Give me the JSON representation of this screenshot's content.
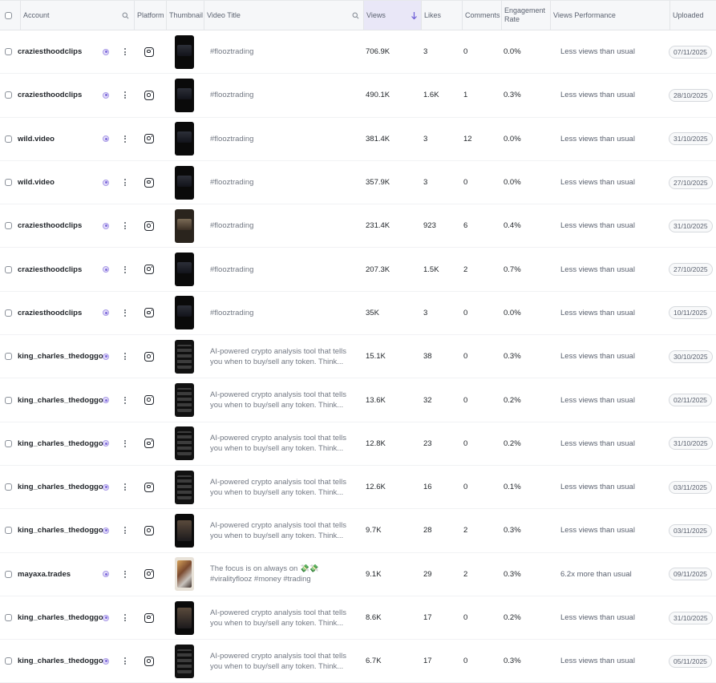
{
  "header": {
    "account": "Account",
    "platform": "Platform",
    "thumbnail": "Thumbnail",
    "video_title": "Video Title",
    "views": "Views",
    "likes": "Likes",
    "comments": "Comments",
    "engagement_line1": "Engagement",
    "engagement_line2": "Rate",
    "views_performance": "Views Performance",
    "uploaded": "Uploaded"
  },
  "rows": [
    {
      "account": "craziesthoodclips",
      "title": "#flooztrading",
      "views": "706.9K",
      "likes": "3",
      "comments": "0",
      "engagement": "0.0%",
      "performance": "Less views than usual",
      "uploaded": "07/11/2025"
    },
    {
      "account": "craziesthoodclips",
      "title": "#flooztrading",
      "views": "490.1K",
      "likes": "1.6K",
      "comments": "1",
      "engagement": "0.3%",
      "performance": "Less views than usual",
      "uploaded": "28/10/2025"
    },
    {
      "account": "wild.video",
      "title": "#flooztrading",
      "views": "381.4K",
      "likes": "3",
      "comments": "12",
      "engagement": "0.0%",
      "performance": "Less views than usual",
      "uploaded": "31/10/2025"
    },
    {
      "account": "wild.video",
      "title": "#flooztrading",
      "views": "357.9K",
      "likes": "3",
      "comments": "0",
      "engagement": "0.0%",
      "performance": "Less views than usual",
      "uploaded": "27/10/2025"
    },
    {
      "account": "craziesthoodclips",
      "title": "#flooztrading",
      "views": "231.4K",
      "likes": "923",
      "comments": "6",
      "engagement": "0.4%",
      "performance": "Less views than usual",
      "uploaded": "31/10/2025"
    },
    {
      "account": "craziesthoodclips",
      "title": "#flooztrading",
      "views": "207.3K",
      "likes": "1.5K",
      "comments": "2",
      "engagement": "0.7%",
      "performance": "Less views than usual",
      "uploaded": "27/10/2025"
    },
    {
      "account": "craziesthoodclips",
      "title": "#flooztrading",
      "views": "35K",
      "likes": "3",
      "comments": "0",
      "engagement": "0.0%",
      "performance": "Less views than usual",
      "uploaded": "10/11/2025"
    },
    {
      "account": "king_charles_thedoggo",
      "title": "AI-powered crypto analysis tool that tells you when to buy/sell any token. Think...",
      "views": "15.1K",
      "likes": "38",
      "comments": "0",
      "engagement": "0.3%",
      "performance": "Less views than usual",
      "uploaded": "30/10/2025"
    },
    {
      "account": "king_charles_thedoggo",
      "title": "AI-powered crypto analysis tool that tells you when to buy/sell any token. Think...",
      "views": "13.6K",
      "likes": "32",
      "comments": "0",
      "engagement": "0.2%",
      "performance": "Less views than usual",
      "uploaded": "02/11/2025"
    },
    {
      "account": "king_charles_thedoggo",
      "title": "AI-powered crypto analysis tool that tells you when to buy/sell any token. Think...",
      "views": "12.8K",
      "likes": "23",
      "comments": "0",
      "engagement": "0.2%",
      "performance": "Less views than usual",
      "uploaded": "31/10/2025"
    },
    {
      "account": "king_charles_thedoggo",
      "title": "AI-powered crypto analysis tool that tells you when to buy/sell any token. Think...",
      "views": "12.6K",
      "likes": "16",
      "comments": "0",
      "engagement": "0.1%",
      "performance": "Less views than usual",
      "uploaded": "03/11/2025"
    },
    {
      "account": "king_charles_thedoggo",
      "title": "AI-powered crypto analysis tool that tells you when to buy/sell any token. Think...",
      "views": "9.7K",
      "likes": "28",
      "comments": "2",
      "engagement": "0.3%",
      "performance": "Less views than usual",
      "uploaded": "03/11/2025"
    },
    {
      "account": "mayaxa.trades",
      "title": "The focus is on always on 💸💸 #viralityflooz #money #trading",
      "views": "9.1K",
      "likes": "29",
      "comments": "2",
      "engagement": "0.3%",
      "performance": "6.2x more than usual",
      "uploaded": "09/11/2025"
    },
    {
      "account": "king_charles_thedoggo",
      "title": "AI-powered crypto analysis tool that tells you when to buy/sell any token. Think...",
      "views": "8.6K",
      "likes": "17",
      "comments": "0",
      "engagement": "0.2%",
      "performance": "Less views than usual",
      "uploaded": "31/10/2025"
    },
    {
      "account": "king_charles_thedoggo",
      "title": "AI-powered crypto analysis tool that tells you when to buy/sell any token. Think...",
      "views": "6.7K",
      "likes": "17",
      "comments": "0",
      "engagement": "0.3%",
      "performance": "Less views than usual",
      "uploaded": "05/11/2025"
    }
  ],
  "icons": {
    "platform": "instagram-icon",
    "badge": "verified-badge-icon",
    "menu": "more-vertical-icon",
    "search": "search-icon",
    "sort": "arrow-down-icon"
  },
  "colors": {
    "views_header_bg": "#e9e7f7",
    "sort_arrow": "#6b5bd6"
  }
}
